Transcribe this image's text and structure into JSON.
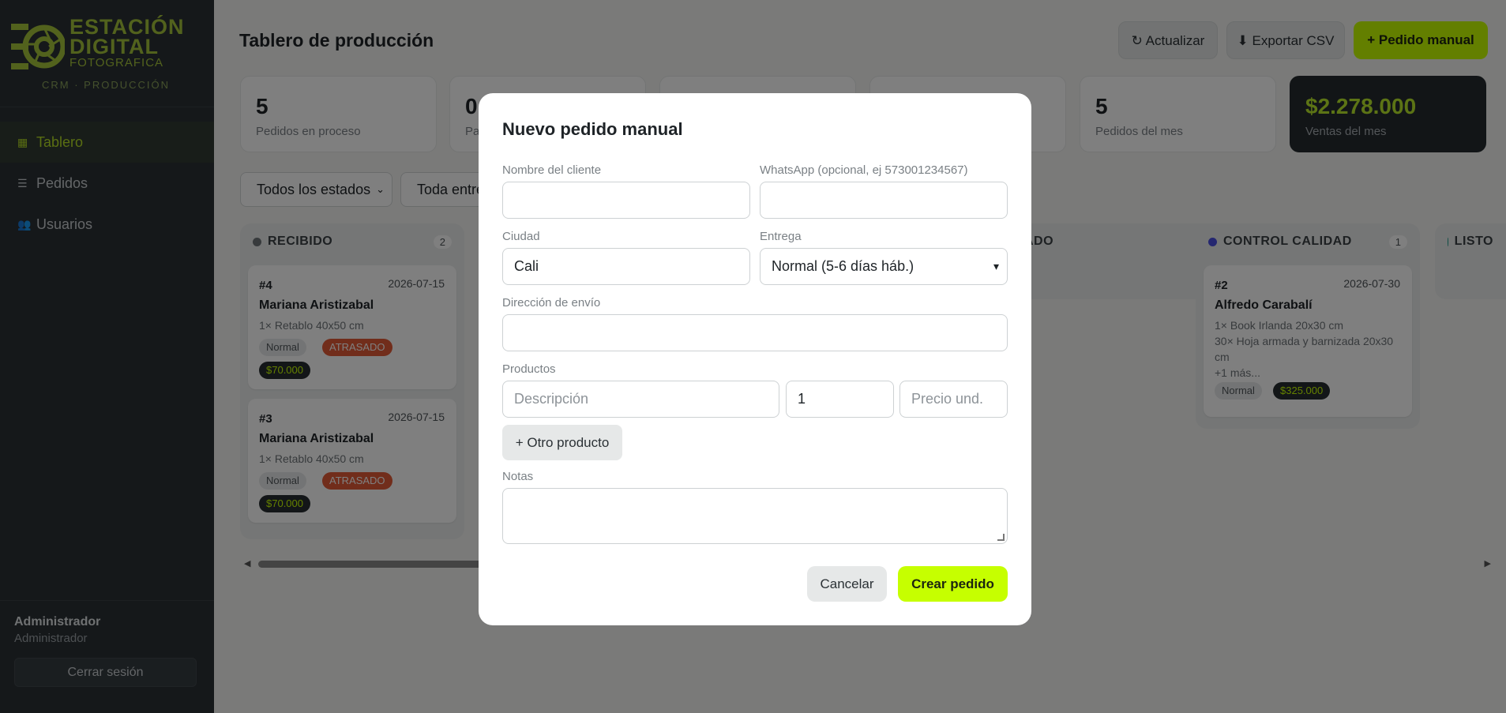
{
  "brand": {
    "line1": "ESTACIÓN",
    "line2": "DIGITAL",
    "line3": "FOTOGRAFICA",
    "sub": "CRM · PRODUCCIÓN"
  },
  "nav": [
    {
      "label": "Tablero",
      "icon": "grid-icon"
    },
    {
      "label": "Pedidos",
      "icon": "list-icon"
    },
    {
      "label": "Usuarios",
      "icon": "users-icon"
    }
  ],
  "user": {
    "name": "Administrador",
    "role": "Administrador",
    "logout": "Cerrar sesión"
  },
  "page": {
    "title": "Tablero de producción"
  },
  "toolbar": {
    "refresh": "↻ Actualizar",
    "export": "⬇ Exportar CSV",
    "new_order": "+ Pedido manual"
  },
  "stats": [
    {
      "value": "5",
      "label": "Pedidos en proceso"
    },
    {
      "value": "0",
      "label": "Pa"
    },
    {
      "value": "",
      "label": ""
    },
    {
      "value": "",
      "label": ""
    },
    {
      "value": "5",
      "label": "Pedidos del mes"
    },
    {
      "value": "$2.278.000",
      "label": "Ventas del mes"
    }
  ],
  "filters": {
    "status": "Todos los estados",
    "delivery": "Toda entre"
  },
  "columns": [
    {
      "title": "RECIBIDO",
      "count": "2",
      "color": "#6e7479"
    },
    {
      "title": "ADO",
      "count": "0",
      "color": "#6e7479"
    },
    {
      "title": "CONTROL CALIDAD",
      "count": "1",
      "color": "#4a4ee0"
    },
    {
      "title": "LISTO",
      "count": "",
      "color": "#1a9a8a"
    }
  ],
  "cards": [
    {
      "id": "#4",
      "date": "2026-07-15",
      "name": "Mariana Aristizabal",
      "items": "1× Retablo 40x50 cm",
      "tag": "Normal",
      "late": "ATRASADO",
      "amount": "$70.000"
    },
    {
      "id": "#3",
      "date": "2026-07-15",
      "name": "Mariana Aristizabal",
      "items": "1× Retablo 40x50 cm",
      "tag": "Normal",
      "late": "ATRASADO",
      "amount": "$70.000"
    },
    {
      "id": "#2",
      "date": "2026-07-30",
      "name": "Alfredo Carabalí",
      "items": "1× Book Irlanda 20x30 cm\n30× Hoja armada y barnizada 20x30 cm\n+1 más...",
      "tag": "Normal",
      "amount": "$325.000"
    }
  ],
  "modal": {
    "title": "Nuevo pedido manual",
    "client_label": "Nombre del cliente",
    "whatsapp_label": "WhatsApp (opcional, ej 573001234567)",
    "city_label": "Ciudad",
    "city_value": "Cali",
    "delivery_label": "Entrega",
    "delivery_value": "Normal (5-6 días háb.)",
    "address_label": "Dirección de envío",
    "products_label": "Productos",
    "desc_placeholder": "Descripción",
    "qty_value": "1",
    "price_placeholder": "Precio und.",
    "add_product": "+ Otro producto",
    "notes_label": "Notas",
    "cancel": "Cancelar",
    "create": "Crear pedido"
  },
  "colors": {
    "accent": "#c6ff00",
    "brand_green": "#a4c43a",
    "sidebar": "#2b3135",
    "late": "#e35a36"
  }
}
